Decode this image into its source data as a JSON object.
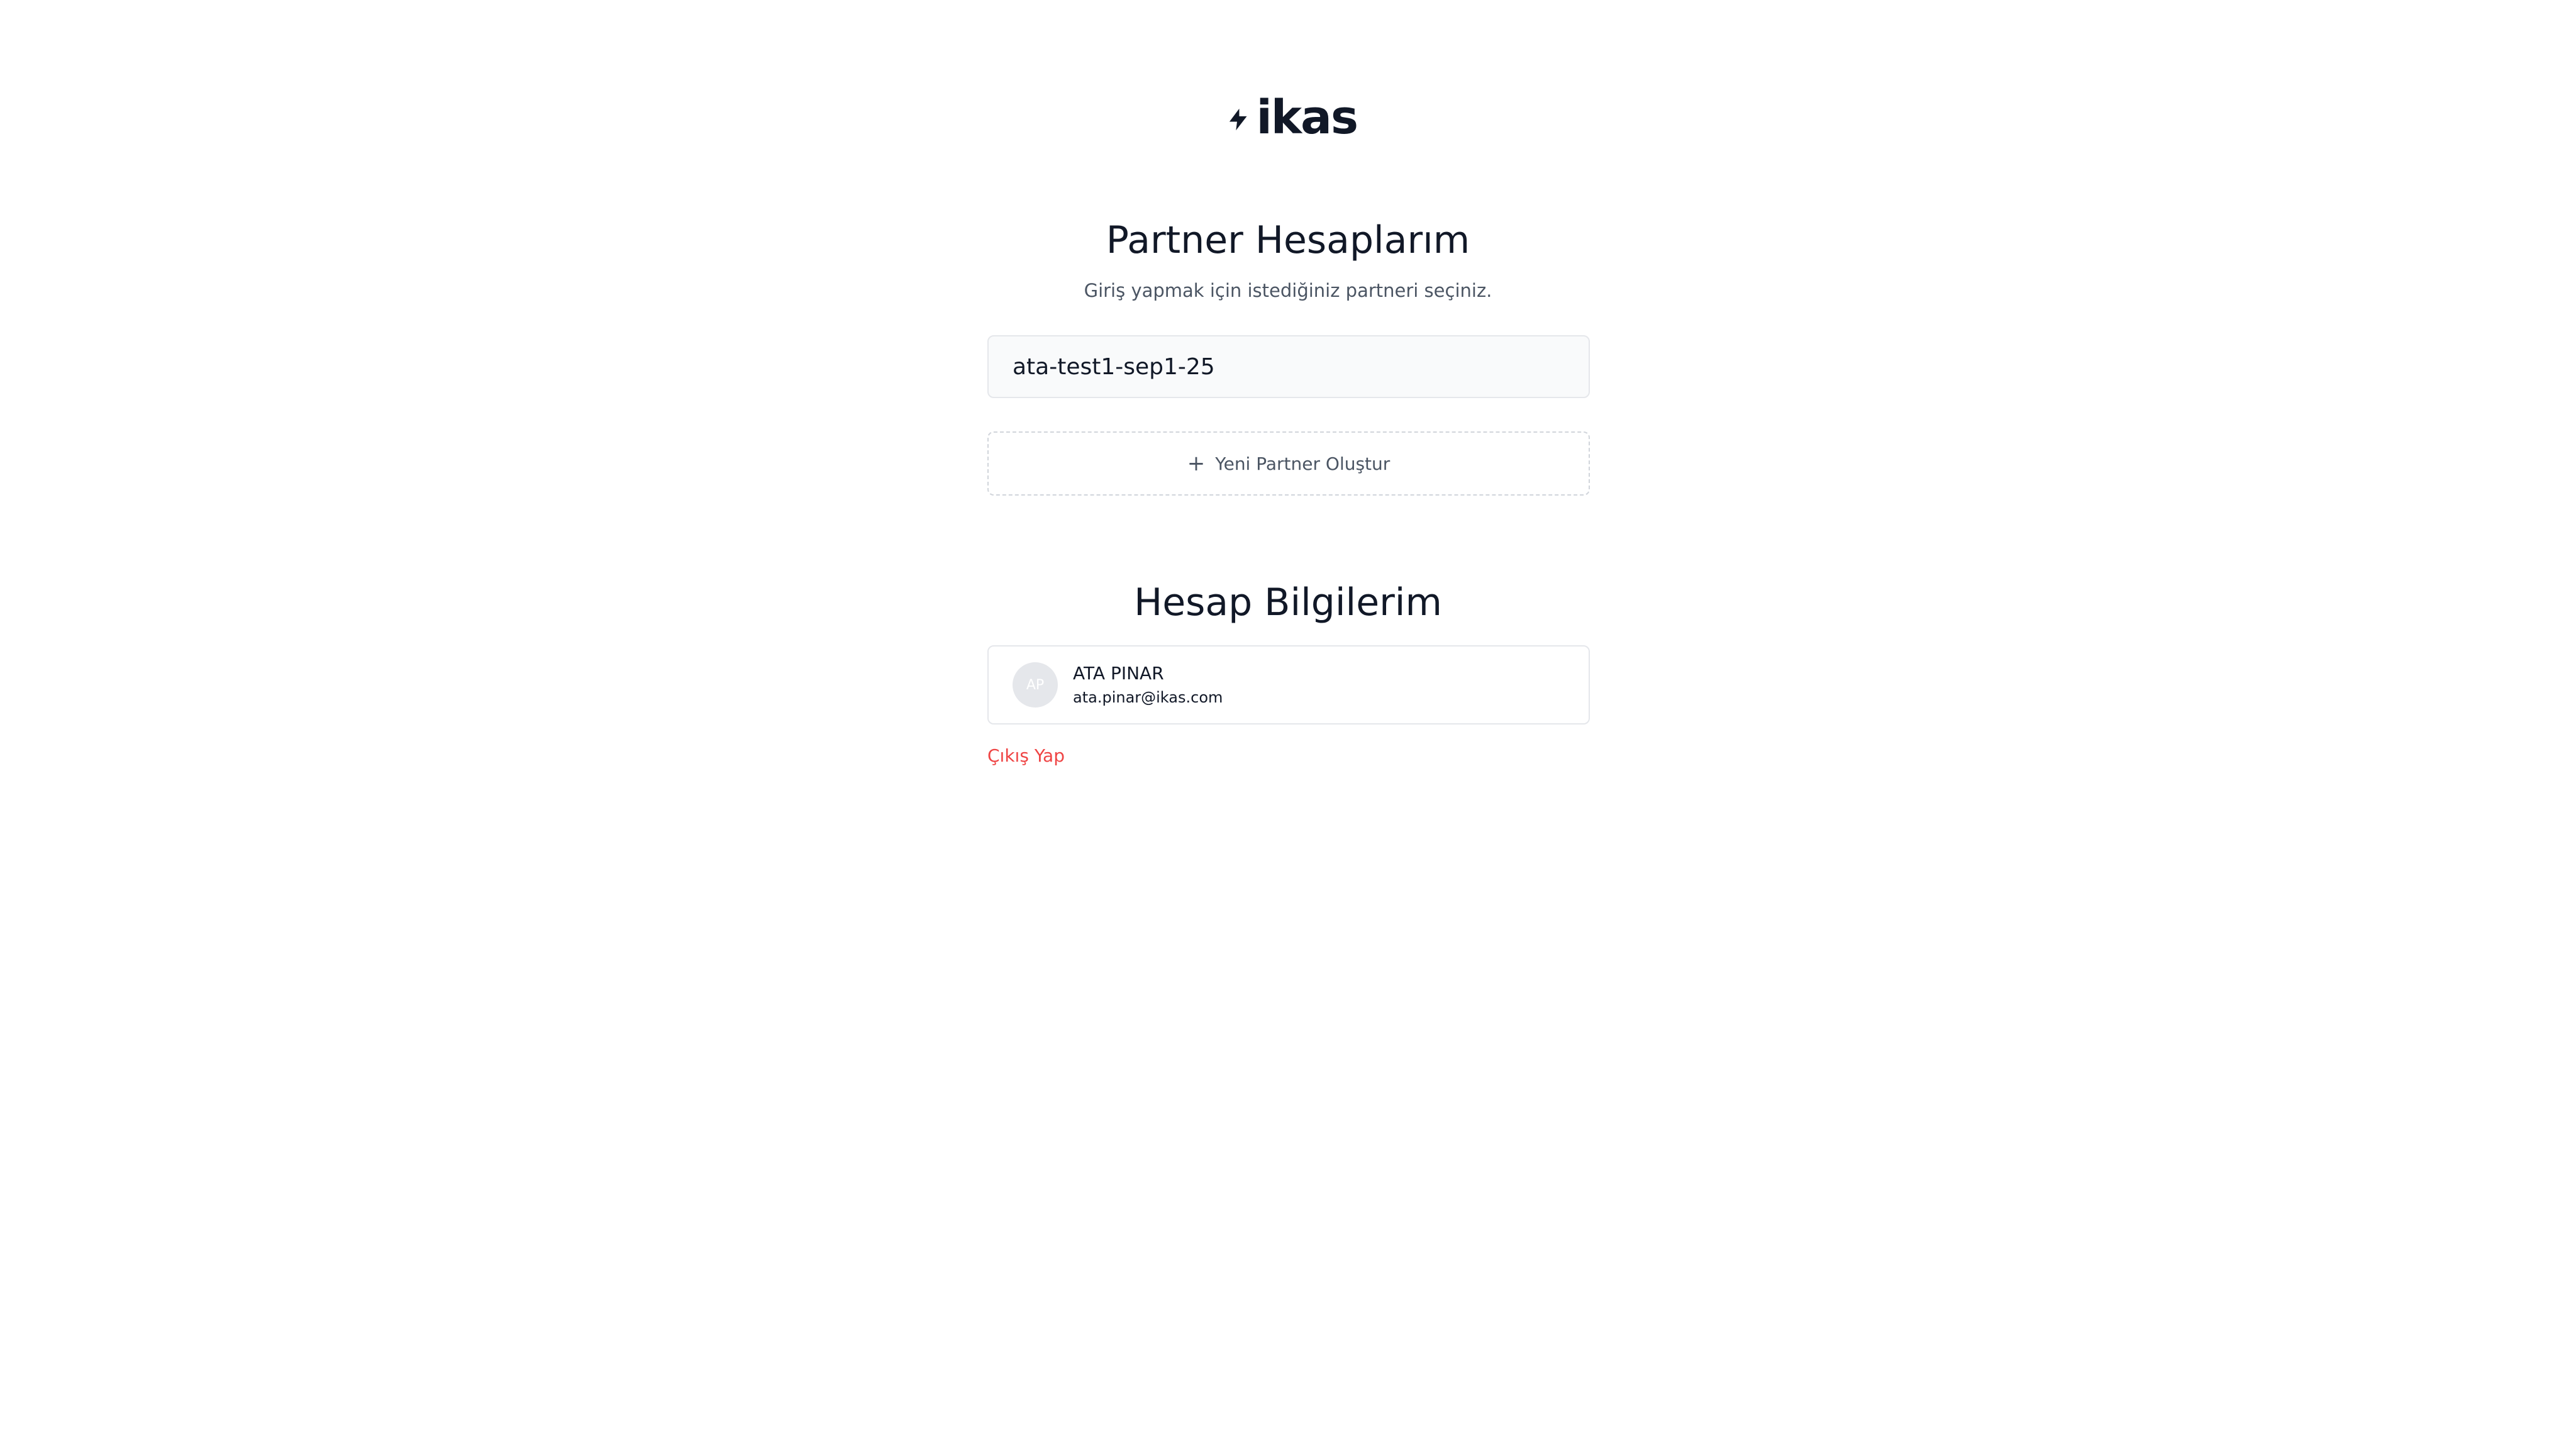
{
  "brand": {
    "name": "ikas",
    "logo_icon": "bolt-icon",
    "color": "#111827"
  },
  "partners_section": {
    "title": "Partner Hesaplarım",
    "subtitle": "Giriş yapmak için istediğiniz partneri seçiniz.",
    "partners": [
      {
        "name": "ata-test1-sep1-25"
      }
    ],
    "new_partner_icon": "plus-icon",
    "new_partner_label": "Yeni Partner Oluştur"
  },
  "account_section": {
    "title": "Hesap Bilgilerim",
    "user": {
      "initials": "AP",
      "name": "ATA PINAR",
      "email": "ata.pinar@ikas.com"
    },
    "logout_label": "Çıkış Yap"
  },
  "colors": {
    "text": "#111827",
    "muted": "#4b5563",
    "border": "#e5e7eb",
    "partner_bg": "#f9fafb",
    "danger": "#ef4444"
  }
}
